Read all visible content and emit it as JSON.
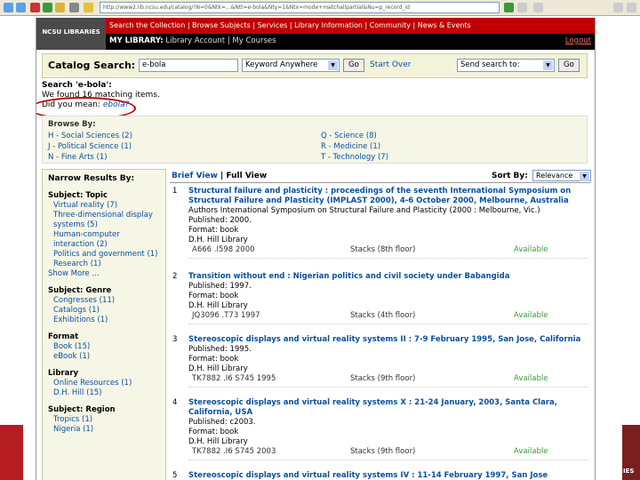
{
  "browser": {
    "address": "http://www2.lib.ncsu.edu/catalog/?N=0&Ntk=...&Ntt=e-bola&Nty=1&Ntx=mode+matchallpartial&Nu=p_record_id"
  },
  "header": {
    "logo": "NCSU LIBRARIES",
    "top_links": "Search the Collection | Browse Subjects | Services | Library Information | Community | News & Events",
    "mylibrary": "MY LIBRARY:",
    "library_account": "Library Account",
    "my_courses": "My Courses",
    "sep": "|",
    "logout": "Logout"
  },
  "search": {
    "label": "Catalog Search:",
    "query": "e-bola",
    "field": "Keyword Anywhere",
    "go": "Go",
    "start_over": "Start Over",
    "send_to": "Send search to:",
    "go2": "Go"
  },
  "notice": {
    "line1": "Search 'e-bola':",
    "line2": "We found 16 matching items.",
    "did_you_mean": "Did you mean: ",
    "suggestion": "ebola?"
  },
  "browse": {
    "title": "Browse By:",
    "items": [
      "H - Social Sciences (2)",
      "J - Political Science (1)",
      "N - Fine Arts (1)",
      "Q - Science (8)",
      "R - Medicine (1)",
      "T - Technology (7)"
    ]
  },
  "narrow": {
    "title": "Narrow Results By:",
    "topic": {
      "heading": "Subject: Topic",
      "items": [
        "Virtual reality (7)",
        "Three-dimensional display systems (5)",
        "Human-computer interaction (2)",
        "Politics and government (1)",
        "Research (1)"
      ],
      "more": "Show More ..."
    },
    "genre": {
      "heading": "Subject: Genre",
      "items": [
        "Congresses (11)",
        "Catalogs (1)",
        "Exhibitions (1)"
      ]
    },
    "format": {
      "heading": "Format",
      "items": [
        "Book (15)",
        "eBook (1)"
      ]
    },
    "library": {
      "heading": "Library",
      "items": [
        "Online Resources (1)",
        "D.H. Hill (15)"
      ]
    },
    "region": {
      "heading": "Subject: Region",
      "items": [
        "Tropics (1)",
        "Nigeria (1)"
      ]
    }
  },
  "results_bar": {
    "brief": "Brief View",
    "sep": " | ",
    "full": "Full View",
    "sort_label": "Sort By:",
    "sort_value": "Relevance"
  },
  "records": [
    {
      "num": "1",
      "title": "Structural failure and plasticity : proceedings of the seventh International Symposium on Structural Failure and Plasticity (IMPLAST 2000), 4-6 October 2000, Melbourne, Australia",
      "authors": "Authors International Symposium on Structural Failure and Plasticity (2000 : Melbourne, Vic.)",
      "published": "Published: 2000.",
      "format": "Format: book",
      "library": "D.H. Hill Library",
      "call": "A666 .I598 2000",
      "loc": "Stacks (8th floor)",
      "status": "Available"
    },
    {
      "num": "2",
      "title": "Transition without end : Nigerian politics and civil society under Babangida",
      "authors": "",
      "published": "Published: 1997.",
      "format": "Format: book",
      "library": "D.H. Hill Library",
      "call": "JQ3096 .T73 1997",
      "loc": "Stacks (4th floor)",
      "status": "Available"
    },
    {
      "num": "3",
      "title": "Stereoscopic displays and virtual reality systems II : 7-9 February 1995, San Jose, California",
      "authors": "",
      "published": "Published: 1995.",
      "format": "Format: book",
      "library": "D.H. Hill Library",
      "call": "TK7882 .I6 S745 1995",
      "loc": "Stacks (9th floor)",
      "status": "Available"
    },
    {
      "num": "4",
      "title": "Stereoscopic displays and virtual reality systems X : 21-24 January, 2003, Santa Clara, California, USA",
      "authors": "",
      "published": "Published: c2003.",
      "format": "Format: book",
      "library": "D.H. Hill Library",
      "call": "TK7882 .I6 S745 2003",
      "loc": "Stacks (9th floor)",
      "status": "Available"
    },
    {
      "num": "5",
      "title": "Stereoscopic displays and virtual reality systems IV : 11-14 February 1997, San Jose",
      "authors": "",
      "published": "",
      "format": "",
      "library": "",
      "call": "",
      "loc": "",
      "status": ""
    }
  ],
  "side_text": "IES"
}
